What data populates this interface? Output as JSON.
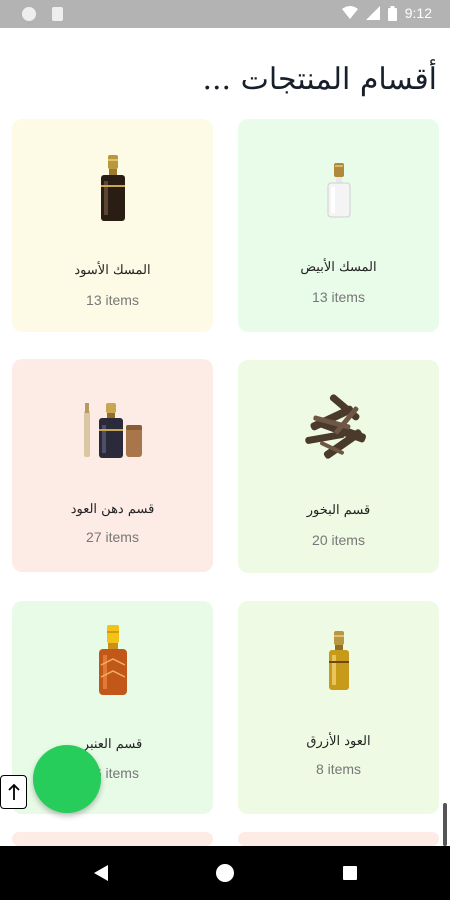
{
  "status_bar": {
    "time": "9:12",
    "left_icons": [
      "notification-circle-icon",
      "sim-card-icon"
    ],
    "right_icons": [
      "wifi-icon",
      "cell-signal-icon",
      "battery-icon"
    ]
  },
  "header": {
    "title": "أقسام المنتجات ..."
  },
  "categories": [
    {
      "name": "المسك الأبيض",
      "count": "13 items",
      "bg": "#e9fbe9",
      "icon": "white-musk-bottle-icon"
    },
    {
      "name": "المسك الأسود",
      "count": "13 items",
      "bg": "#fdfbe6",
      "icon": "black-musk-bottle-icon"
    },
    {
      "name": "قسم البخور",
      "count": "20 items",
      "bg": "#eefae4",
      "icon": "incense-wood-icon"
    },
    {
      "name": "قسم دهن العود",
      "count": "27 items",
      "bg": "#fdebe6",
      "icon": "oud-oil-bottle-icon"
    },
    {
      "name": "العود الأزرق",
      "count": "8 items",
      "bg": "#eefae4",
      "icon": "blue-oud-bottle-icon"
    },
    {
      "name": "قسم العنبر",
      "count": "16 items",
      "bg": "#e7fbe7",
      "icon": "amber-bottle-icon"
    }
  ],
  "colors": {
    "fab": "#27cd5a",
    "title": "#17202a"
  },
  "nav": {
    "icons": [
      "back-icon",
      "home-icon",
      "recents-icon"
    ]
  }
}
